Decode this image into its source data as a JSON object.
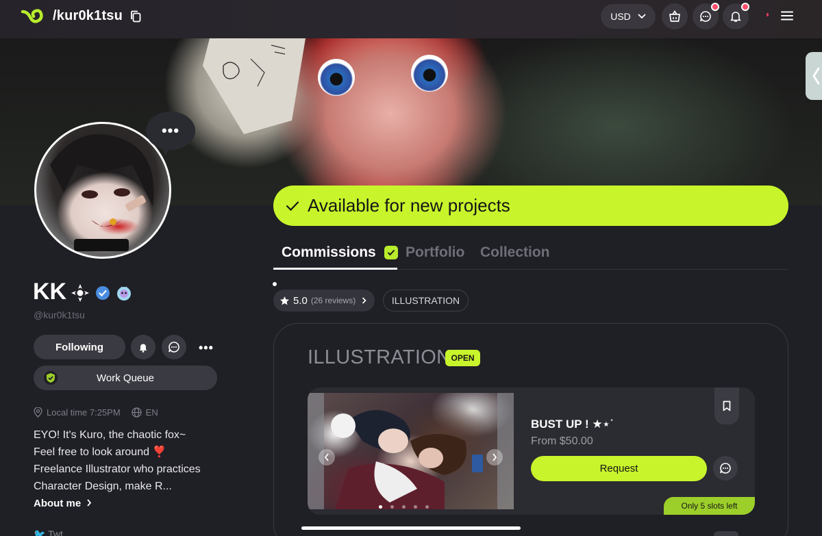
{
  "header": {
    "handle": "/kur0k1tsu",
    "currency": "USD",
    "colors": {
      "accent": "#c8f42c",
      "notification": "#ff4d6a",
      "background": "#1f1f26"
    }
  },
  "profile": {
    "display_name": "KK",
    "username": "@kur0k1tsu",
    "bubble_text": "•••",
    "following_label": "Following",
    "more_label": "•••",
    "work_queue_label": "Work Queue",
    "local_time": "Local time 7:25PM",
    "language": "EN",
    "bio_lines": [
      "EYO! It's Kuro, the chaotic fox~",
      "Feel free to look around ❣️",
      "Freelance Illustrator who practices",
      "Character Design, make R..."
    ],
    "about_me_label": "About me",
    "social_label": "Twt"
  },
  "main": {
    "availability": "Available for new projects",
    "tabs": [
      {
        "label": "Commissions"
      },
      {
        "label": "Portfolio"
      },
      {
        "label": "Collection"
      }
    ],
    "rating": {
      "score": "5.0",
      "reviews": "(26 reviews)"
    },
    "category_filter": "ILLUSTRATION",
    "section": {
      "title": "ILLUSTRATION",
      "status": "OPEN"
    },
    "item": {
      "title": "BUST UP ! ★⋆˙",
      "price": "From $50.00",
      "request_label": "Request",
      "slots": "Only 5 slots left",
      "image_count": 5,
      "current_image": 1
    }
  }
}
